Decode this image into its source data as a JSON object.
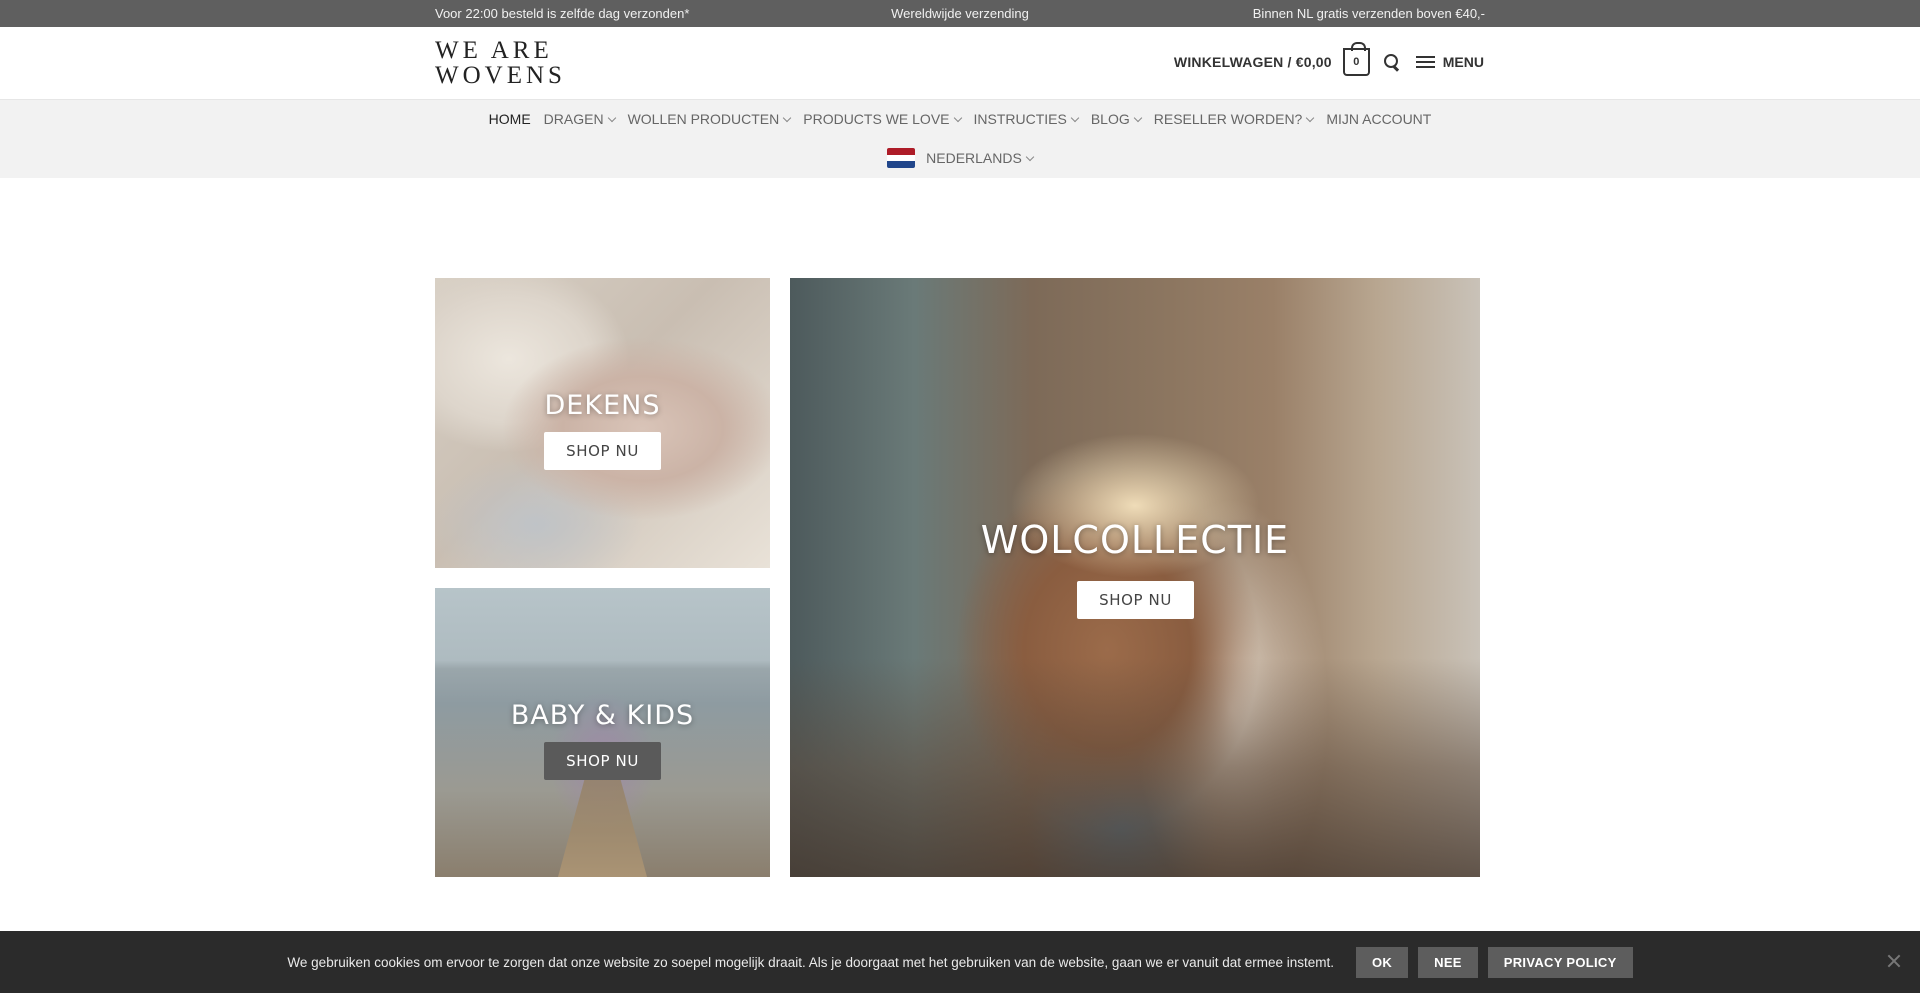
{
  "topbar": {
    "left": "Voor 22:00 besteld is zelfde dag verzonden*",
    "center": "Wereldwijde verzending",
    "right": "Binnen NL gratis verzenden boven €40,-"
  },
  "header": {
    "logo_line1": "WE ARE",
    "logo_line2": "WOVENS",
    "cart_label": "WINKELWAGEN / €0,00",
    "cart_count": "0",
    "menu_label": "MENU"
  },
  "nav": {
    "items": [
      {
        "label": "HOME",
        "active": true,
        "dropdown": false
      },
      {
        "label": "DRAGEN",
        "active": false,
        "dropdown": true
      },
      {
        "label": "WOLLEN PRODUCTEN",
        "active": false,
        "dropdown": true
      },
      {
        "label": "PRODUCTS WE LOVE",
        "active": false,
        "dropdown": true
      },
      {
        "label": "INSTRUCTIES",
        "active": false,
        "dropdown": true
      },
      {
        "label": "BLOG",
        "active": false,
        "dropdown": true
      },
      {
        "label": "RESELLER WORDEN?",
        "active": false,
        "dropdown": true
      },
      {
        "label": "MIJN ACCOUNT",
        "active": false,
        "dropdown": false
      }
    ],
    "language": "NEDERLANDS",
    "flag_colors": [
      "#ae1c28",
      "#ffffff",
      "#21468b"
    ]
  },
  "tiles": {
    "dekens": {
      "title": "DEKENS",
      "button": "SHOP NU"
    },
    "baby": {
      "title": "BABY & KIDS",
      "button": "SHOP NU"
    },
    "wol": {
      "title": "WOLCOLLECTIE",
      "button": "SHOP NU"
    }
  },
  "cookie": {
    "text": "We gebruiken cookies om ervoor te zorgen dat onze website zo soepel mogelijk draait. Als je doorgaat met het gebruiken van de website, gaan we er vanuit dat ermee instemt.",
    "ok": "OK",
    "nee": "NEE",
    "privacy": "PRIVACY POLICY"
  }
}
